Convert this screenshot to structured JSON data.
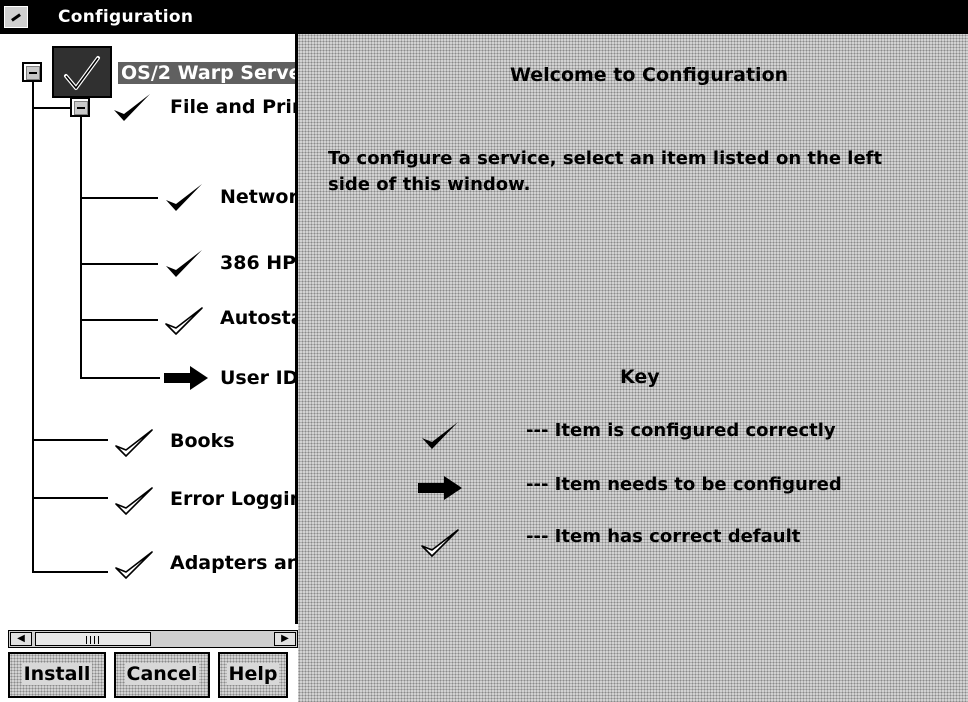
{
  "window": {
    "title": "Configuration",
    "sysmenu_icon": "system-menu-icon"
  },
  "tree": {
    "root": {
      "label": "OS/2 Warp Serve",
      "icon": "check-selected-icon"
    },
    "group": {
      "label": "File and Prir",
      "icon": "check-bold-icon"
    },
    "children": [
      {
        "label": "Network",
        "icon": "check-bold-icon"
      },
      {
        "label": "386 HP",
        "icon": "check-bold-icon"
      },
      {
        "label": "Autosta",
        "icon": "check-outline-icon"
      },
      {
        "label": "User ID",
        "icon": "arrow-right-icon"
      }
    ],
    "siblings": [
      {
        "label": "Books",
        "icon": "check-outline-icon"
      },
      {
        "label": "Error Logging",
        "icon": "check-outline-icon"
      },
      {
        "label": "Adapters and",
        "icon": "check-outline-icon"
      }
    ]
  },
  "buttons": {
    "install": "Install",
    "cancel": "Cancel",
    "help": "Help"
  },
  "content": {
    "welcome": "Welcome to Configuration",
    "instruction": "To configure a service, select an item listed on the left side of this window.",
    "key_title": "Key",
    "key": [
      {
        "icon": "check-bold-icon",
        "text": "--- Item is configured correctly"
      },
      {
        "icon": "arrow-right-icon",
        "text": "--- Item needs to be configured"
      },
      {
        "icon": "check-outline-icon",
        "text": "--- Item has correct default"
      }
    ]
  }
}
